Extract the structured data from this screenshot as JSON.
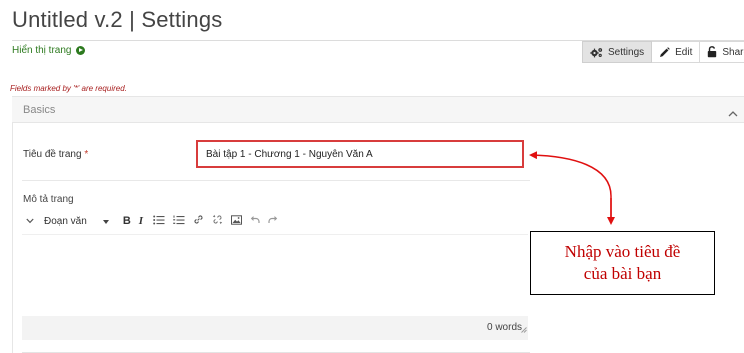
{
  "page": {
    "title": "Untitled v.2 | Settings",
    "view_link": "Hiển thị trang"
  },
  "tabs": [
    {
      "label": "Settings",
      "icon": "gears-icon",
      "active": true
    },
    {
      "label": "Edit",
      "icon": "pencil-icon",
      "active": false
    },
    {
      "label": "Share",
      "icon": "unlock-icon",
      "active": false
    }
  ],
  "form": {
    "required_note": "Fields marked by '*' are required.",
    "section_label": "Basics",
    "title_label": "Tiêu đề trang",
    "required_mark": "*",
    "title_value": "Bài tập 1 - Chương 1 - Nguyễn Văn A",
    "description_label": "Mô tả trang"
  },
  "editor": {
    "format_select": "Đoạn văn",
    "word_count": "0 words",
    "content": ""
  },
  "callout": {
    "line1": "Nhập vào tiêu đề",
    "line2": "của bài bạn"
  },
  "colors": {
    "accent_link": "#2d7a1f",
    "highlight_border": "#d83c3c",
    "callout_text": "#c00000",
    "required": "#a82020"
  }
}
